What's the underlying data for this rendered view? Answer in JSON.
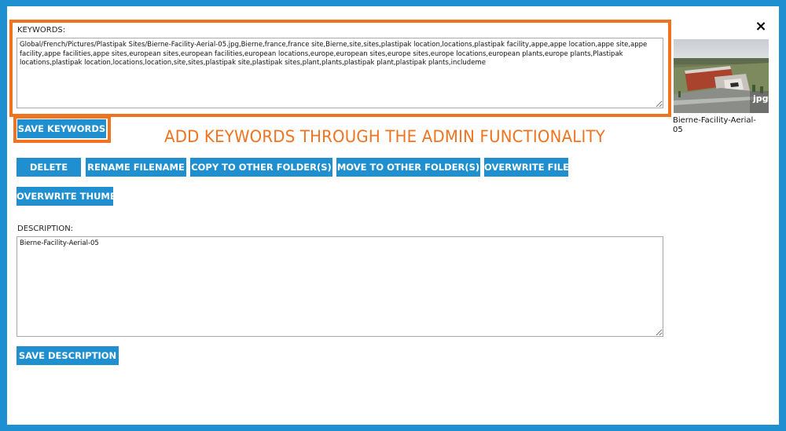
{
  "keywords": {
    "label": "KEYWORDS:",
    "value": "Global/French/Pictures/Plastipak Sites/Bierne-Facility-Aerial-05.jpg,Bierne,france,france site,Bierne,site,sites,plastipak location,locations,plastipak facility,appe,appe location,appe site,appe facility,appe facilities,appe sites,european sites,european facilities,european locations,europe,european sites,europe sites,europe locations,european plants,europe plants,Plastipak locations,plastipak location,locations,location,site,sites,plastipak site,plastipak sites,plant,plants,plastipak plant,plastipak plants,includeme",
    "save_label": "SAVE KEYWORDS"
  },
  "annotation": "ADD KEYWORDS THROUGH THE ADMIN FUNCTIONALITY",
  "actions": {
    "delete": "DELETE",
    "rename": "RENAME FILENAME",
    "copy": "COPY TO OTHER FOLDER(S)",
    "move": "MOVE TO OTHER FOLDER(S)",
    "overwrite_file": "OVERWRITE FILE",
    "overwrite_thumb": "OVERWRITE THUMB"
  },
  "description": {
    "label": "DESCRIPTION:",
    "value": "Bierne-Facility-Aerial-05",
    "save_label": "SAVE DESCRIPTION"
  },
  "close_icon": "×",
  "preview": {
    "caption": "Bierne-Facility-Aerial-05",
    "badge": "jpg"
  },
  "colors": {
    "background": "#1e8fd0",
    "button": "#1f8fcf",
    "highlight": "#f07320"
  }
}
